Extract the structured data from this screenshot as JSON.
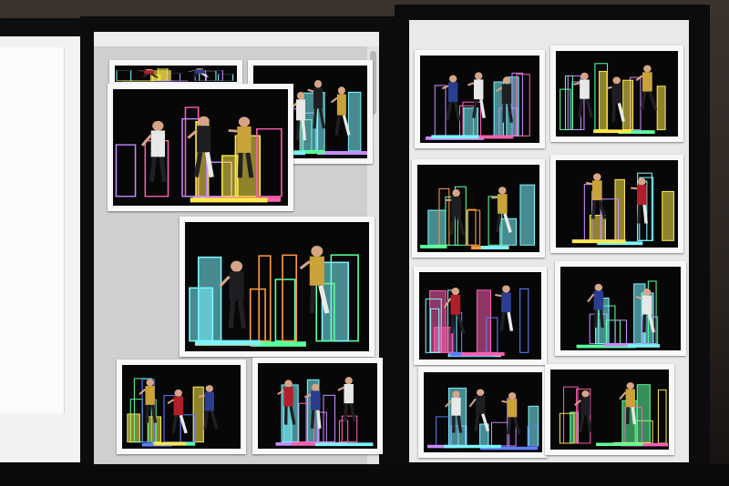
{
  "scene": {
    "description_colors": {
      "bezel": "#0c0c0e",
      "paper": "#f8f8f8",
      "photo_bg": "#070708"
    },
    "neon_palette": [
      "#ffe94a",
      "#7cf5ff",
      "#c58cff",
      "#5bff9c",
      "#ff5fb0",
      "#ff9a3c",
      "#5f7dff"
    ]
  },
  "monitors": [
    {
      "id": "left",
      "role": "partial-monitor"
    },
    {
      "id": "middle",
      "role": "contact-sheet-window"
    },
    {
      "id": "right",
      "role": "contact-sheet-window"
    }
  ],
  "photos": [
    {
      "id": "m-top-left-strip",
      "figures": 2,
      "palette": [
        0,
        1,
        2
      ]
    },
    {
      "id": "m-top-right",
      "figures": 4,
      "palette": [
        1,
        2,
        3
      ]
    },
    {
      "id": "m-large-1",
      "figures": 3,
      "palette": [
        0,
        2,
        4
      ]
    },
    {
      "id": "m-large-2",
      "figures": 2,
      "palette": [
        1,
        3,
        5
      ]
    },
    {
      "id": "m-bottom-left",
      "figures": 3,
      "palette": [
        0,
        3,
        6
      ]
    },
    {
      "id": "m-bottom-right",
      "figures": 3,
      "palette": [
        1,
        2,
        4
      ]
    },
    {
      "id": "r-1",
      "figures": 3,
      "palette": [
        1,
        2,
        4
      ]
    },
    {
      "id": "r-2",
      "figures": 3,
      "palette": [
        0,
        2,
        3
      ]
    },
    {
      "id": "r-3",
      "figures": 2,
      "palette": [
        1,
        5,
        3
      ]
    },
    {
      "id": "r-4",
      "figures": 2,
      "palette": [
        0,
        1,
        2
      ]
    },
    {
      "id": "r-5",
      "figures": 2,
      "palette": [
        4,
        1,
        6
      ]
    },
    {
      "id": "r-6",
      "figures": 2,
      "palette": [
        1,
        3,
        2
      ]
    },
    {
      "id": "r-7",
      "figures": 3,
      "palette": [
        1,
        2,
        6
      ]
    },
    {
      "id": "r-8",
      "figures": 2,
      "palette": [
        3,
        0,
        4
      ]
    }
  ]
}
